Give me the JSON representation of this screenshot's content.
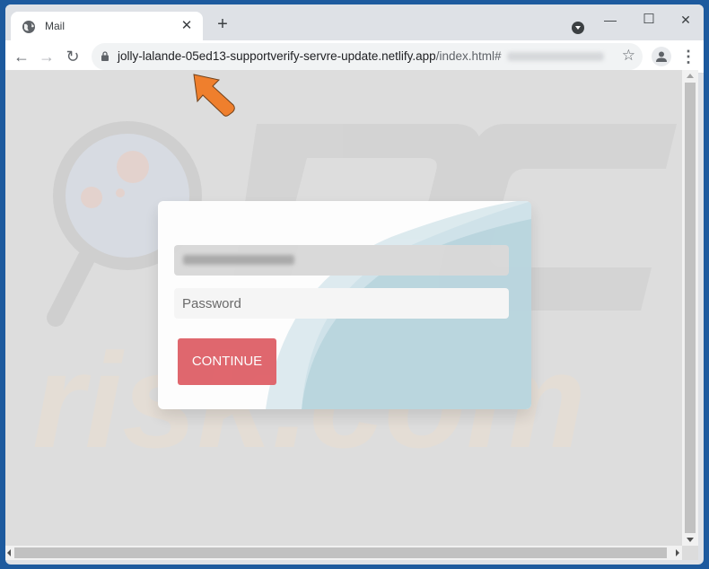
{
  "browser": {
    "tab": {
      "title": "Mail",
      "icon": "globe-icon",
      "close_label": "✕"
    },
    "new_tab_label": "+",
    "window_controls": {
      "minimize": "—",
      "maximize": "☐",
      "close": "✕"
    },
    "nav": {
      "back": "←",
      "forward": "→",
      "reload": "↻"
    },
    "address": {
      "host": "jolly-lalande-05ed13-supportverify-servre-update.netlify.app",
      "path": "/index.html#",
      "fragment_blurred": true,
      "secure_icon": "lock-icon"
    },
    "bookmark_icon": "☆",
    "menu_icon": "⋮"
  },
  "page": {
    "email_field": {
      "value_blurred": true
    },
    "password_field": {
      "placeholder": "Password"
    },
    "continue_button": {
      "label": "CONTINUE"
    },
    "colors": {
      "button": "#e0636a",
      "card_wave": "#b9d6df",
      "background": "#dddddd",
      "annotation_arrow": "#f07a24"
    }
  },
  "watermark": {
    "text": "risk.com",
    "logo": "PC"
  }
}
